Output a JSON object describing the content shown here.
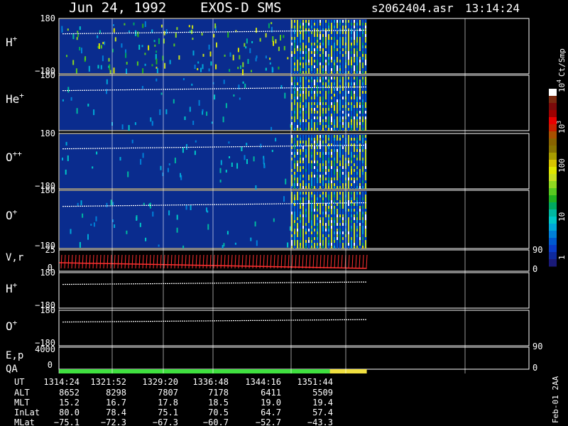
{
  "header": {
    "date": "Jun 24, 1992",
    "instrument": "EXOS-D SMS",
    "file": "s2062404.asr",
    "time": "13:14:24"
  },
  "colorbar": {
    "unit_label": "Ct/Smp",
    "ticks": [
      "1",
      "10",
      "100",
      "10",
      "10"
    ],
    "tick_exponents": [
      "",
      "",
      "",
      "3",
      "4"
    ],
    "colors": [
      "#1a1a78",
      "#0f2a9c",
      "#0a3cc8",
      "#005ad0",
      "#0080d8",
      "#00a8d8",
      "#00c8c8",
      "#00b8a0",
      "#00a860",
      "#20b020",
      "#58c820",
      "#90d820",
      "#c8e020",
      "#e0e800",
      "#d8c400",
      "#a89c00",
      "#887400",
      "#886400",
      "#a85000",
      "#c82000",
      "#e80000",
      "#a00000",
      "#7a0a0a",
      "#7a2a10",
      "#ffffff"
    ]
  },
  "side_label": "Feb-01 2AA",
  "panels": [
    {
      "id": "h-plus",
      "label": "H",
      "sup": "+",
      "ymax": "180",
      "ymin": "−180"
    },
    {
      "id": "he-plus",
      "label": "He",
      "sup": "+",
      "ymax": "180",
      "ymin": ""
    },
    {
      "id": "o-plusplus",
      "label": "O",
      "sup": "++",
      "ymax": "180",
      "ymin": "−180"
    },
    {
      "id": "o-plus",
      "label": "O",
      "sup": "+",
      "ymax": "180",
      "ymin": "−180"
    }
  ],
  "vr_panel": {
    "label": "V,r",
    "ytop": "25",
    "ybottom": "0",
    "right_top": "90",
    "right_bottom": "0"
  },
  "lower_panels": [
    {
      "id": "h-plus-2",
      "label": "H",
      "sup": "+",
      "ymax": "180",
      "ymin": "−180"
    },
    {
      "id": "o-plus-2",
      "label": "O",
      "sup": "+",
      "ymax": "180",
      "ymin": "−180"
    }
  ],
  "ep_panel": {
    "label1": "E,p",
    "label2": "QA",
    "ytop": "4000",
    "ybottom": "0",
    "right_top": "90",
    "right_bottom": "0"
  },
  "ephemeris": {
    "row_labels": [
      "UT",
      "ALT",
      "MLT",
      "InLat",
      "MLat"
    ],
    "columns": [
      [
        "1314:24",
        "8652",
        "15.2",
        "80.0",
        "−75.1"
      ],
      [
        "1321:52",
        "8298",
        "16.7",
        "78.4",
        "−72.3"
      ],
      [
        "1329:20",
        "7807",
        "17.8",
        "75.1",
        "−67.3"
      ],
      [
        "1336:48",
        "7178",
        "18.5",
        "70.5",
        "−60.7"
      ],
      [
        "1344:16",
        "6411",
        "19.0",
        "64.7",
        "−52.7"
      ],
      [
        "1351:44",
        "5509",
        "19.4",
        "57.4",
        "−43.3"
      ]
    ]
  },
  "qa_bar": {
    "green_fraction": 0.88,
    "yellow_fraction": 0.12,
    "green": "#40e040",
    "yellow": "#f0e040"
  },
  "data_coverage_fraction": 0.655,
  "dense_region_start_fraction": 0.5
}
